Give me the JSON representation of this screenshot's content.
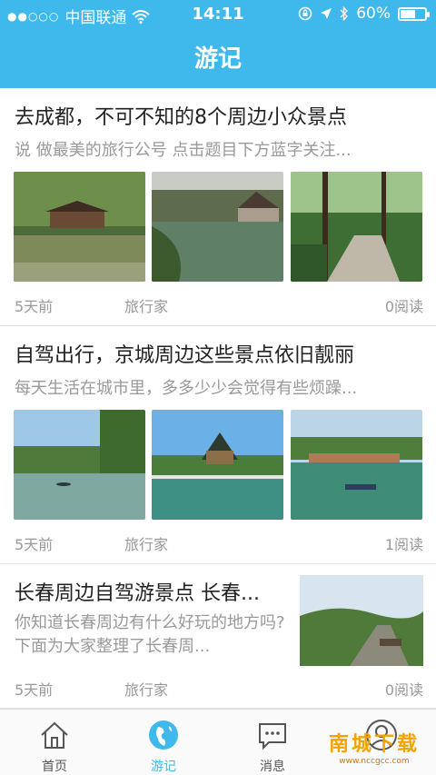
{
  "status_bar": {
    "carrier": "中国联通",
    "time": "14:11",
    "battery": "60%",
    "battery_level": 0.6
  },
  "header": {
    "title": "游记"
  },
  "articles": [
    {
      "title": "去成都，不可不知的8个周边小众景点",
      "summary": "说 做最美的旅行公号  点击题目下方蓝字关注...",
      "date": "5天前",
      "author": "旅行家",
      "reads": "0阅读"
    },
    {
      "title": "自驾出行，京城周边这些景点依旧靓丽",
      "summary": "每天生活在城市里，多多少少会觉得有些烦躁...",
      "date": "5天前",
      "author": "旅行家",
      "reads": "1阅读"
    },
    {
      "title": "长春周边自驾游景点 长春...",
      "summary": "你知道长春周边有什么好玩的地方吗?下面为大家整理了长春周...",
      "date": "5天前",
      "author": "旅行家",
      "reads": "0阅读"
    }
  ],
  "tabbar": {
    "home": "首页",
    "travel": "游记",
    "messages": "消息",
    "profile": ""
  },
  "watermark": {
    "main": "南城下载",
    "sub": "www.nccgcc.com"
  },
  "colors": {
    "accent": "#3fb8ec",
    "text": "#222222",
    "muted": "#999999"
  }
}
